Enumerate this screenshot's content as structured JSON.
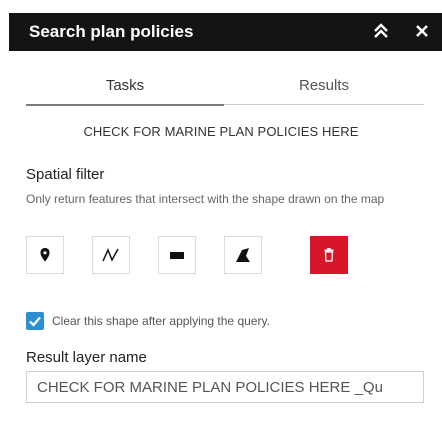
{
  "header": {
    "title": "Search plan policies",
    "collapse_icon": "double-chevron-up-icon",
    "close_icon": "close-icon"
  },
  "tabs": [
    {
      "label": "Tasks",
      "active": true
    },
    {
      "label": "Results",
      "active": false
    }
  ],
  "query": {
    "name": "CHECK FOR MARINE PLAN POLICIES HERE"
  },
  "spatial_filter": {
    "title": "Spatial filter",
    "description": "Only return features that intersect with the shape drawn on the map",
    "tools": [
      {
        "icon": "point-icon"
      },
      {
        "icon": "polyline-icon"
      },
      {
        "icon": "rectangle-icon"
      },
      {
        "icon": "polygon-icon"
      },
      {
        "icon": "trash-icon"
      }
    ],
    "clear_option": {
      "label": "Clear this shape after applying the query.",
      "checked": true
    }
  },
  "result_layer": {
    "title": "Result layer name",
    "value": "CHECK FOR MARINE PLAN POLICIES HERE _Qu"
  },
  "colors": {
    "header_bg": "#141414",
    "accent_blue": "#2b8fd1",
    "delete_red": "#d7162a"
  }
}
